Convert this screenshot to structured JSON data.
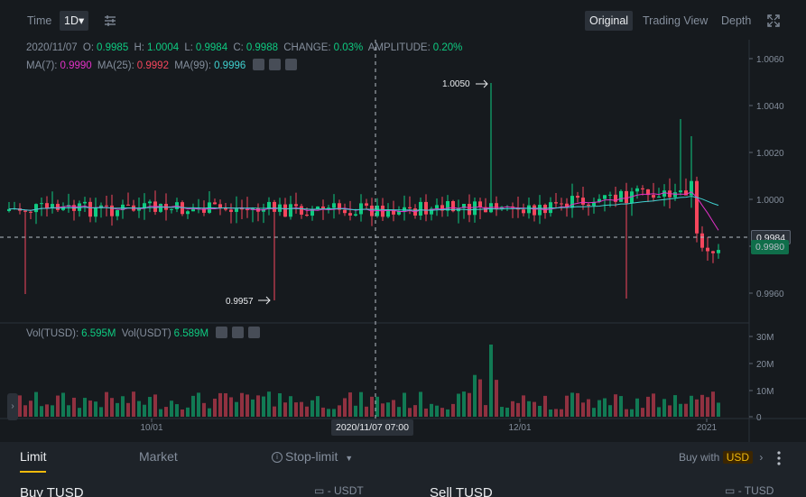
{
  "toolbar": {
    "time_label": "Time",
    "interval": "1D▾",
    "views": [
      "Original",
      "Trading View",
      "Depth"
    ],
    "active_view": "Original"
  },
  "ohlc": {
    "date": "2020/11/07",
    "o_label": "O:",
    "o": "0.9985",
    "h_label": "H:",
    "h": "1.0004",
    "l_label": "L:",
    "l": "0.9984",
    "c_label": "C:",
    "c": "0.9988",
    "change_label": "CHANGE:",
    "change": "0.03%",
    "amp_label": "AMPLITUDE:",
    "amp": "0.20%"
  },
  "ma": {
    "ma7_label": "MA(7):",
    "ma7": "0.9990",
    "ma25_label": "MA(25):",
    "ma25": "0.9992",
    "ma99_label": "MA(99):",
    "ma99": "0.9996"
  },
  "vol": {
    "tusd_label": "Vol(TUSD):",
    "tusd": "6.595M",
    "usdt_label": "Vol(USDT)",
    "usdt": "6.589M"
  },
  "price_axis": [
    "1.0060",
    "1.0040",
    "1.0020",
    "1.0000",
    "0.9980",
    "0.9960"
  ],
  "vol_axis": [
    "30M",
    "20M",
    "10M",
    "0"
  ],
  "time_axis": [
    "10/01",
    "12/01",
    "2021"
  ],
  "crosshair_time": "2020/11/07 07:00",
  "high_marker": "1.0050",
  "low_marker": "0.9957",
  "last_price": "0.9984",
  "last_price_hidden": "0.9980",
  "colors": {
    "up": "#0ecb81",
    "down": "#f6465d",
    "ma7": "#e231c7",
    "ma25": "#f6465d",
    "ma99": "#3fd0cf",
    "accent": "#f0b90b"
  },
  "order": {
    "tabs": [
      "Limit",
      "Market",
      "Stop-limit"
    ],
    "active_tab": "Limit",
    "buy_with_label": "Buy with",
    "buy_with_currency": "USD",
    "buy_title": "Buy TUSD",
    "sell_title": "Sell TUSD",
    "buy_balance": "- USDT",
    "sell_balance": "- TUSD"
  }
}
